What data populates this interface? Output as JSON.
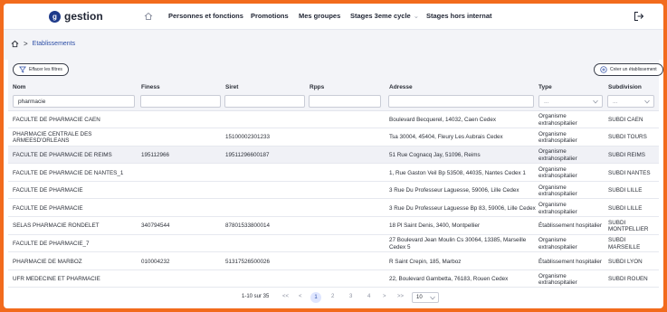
{
  "app": {
    "logo_text": "gestion"
  },
  "nav": {
    "items": [
      {
        "label": "Personnes et fonctions"
      },
      {
        "label": "Promotions"
      },
      {
        "label": "Mes groupes"
      },
      {
        "label": "Stages 3eme cycle",
        "caret": "⌄"
      },
      {
        "label": "Stages hors internat"
      }
    ]
  },
  "breadcrumb": {
    "current": "Etablissements",
    "separator": ">"
  },
  "toolbar": {
    "clear_filters": "Effacer les filtres",
    "create": "Créer un établissement"
  },
  "table": {
    "columns": [
      "Nom",
      "Finess",
      "Siret",
      "Rpps",
      "Adresse",
      "Type",
      "Subdivision"
    ],
    "filters": {
      "nom_value": "pharmacie",
      "type_placeholder": "...",
      "subdivision_placeholder": "..."
    },
    "rows": [
      {
        "nom": "FACULTE DE PHARMACIE CAEN",
        "finess": "",
        "siret": "",
        "rpps": "",
        "adresse": "Boulevard Becquerel, 14032, Caen Cedex",
        "type": "Organisme extrahospitalier",
        "subdivision": "SUBDI CAEN"
      },
      {
        "nom": "PHARMACIE CENTRALE DES ARMEESD'ORLEANS",
        "finess": "",
        "siret": "15100002301233",
        "rpps": "",
        "adresse": "Tsa 30004, 45404, Fleury Les Aubrais Cedex",
        "type": "Organisme extrahospitalier",
        "subdivision": "SUBDI TOURS"
      },
      {
        "nom": "FACULTE DE PHARMACIE DE REIMS",
        "finess": "195112966",
        "siret": "19511296600187",
        "rpps": "",
        "adresse": "51 Rue Cognacq Jay, 51096, Reims",
        "type": "Organisme extrahospitalier",
        "subdivision": "SUBDI REIMS"
      },
      {
        "nom": "FACULTE DE PHARMACIE DE NANTES_1",
        "finess": "",
        "siret": "",
        "rpps": "",
        "adresse": "1, Rue Gaston Veil Bp 53508, 44035, Nantes Cedex 1",
        "type": "Organisme extrahospitalier",
        "subdivision": "SUBDI NANTES"
      },
      {
        "nom": "FACULTE DE PHARMACIE",
        "finess": "",
        "siret": "",
        "rpps": "",
        "adresse": "3 Rue Du Professeur Laguesse, 59006, Lille Cedex",
        "type": "Organisme extrahospitalier",
        "subdivision": "SUBDI LILLE"
      },
      {
        "nom": "FACULTE DE PHARMACIE",
        "finess": "",
        "siret": "",
        "rpps": "",
        "adresse": "3 Rue Du Professeur Laguesse Bp 83, 59006, Lille Cedex",
        "type": "Organisme extrahospitalier",
        "subdivision": "SUBDI LILLE"
      },
      {
        "nom": "SELAS PHARMACIE RONDELET",
        "finess": "340794544",
        "siret": "87801533800014",
        "rpps": "",
        "adresse": "18 Pl Saint Denis, 3400, Montpellier",
        "type": "Établissement hospitalier",
        "subdivision": "SUBDI MONTPELLIER"
      },
      {
        "nom": "FACULTE DE PHARMACIE_7",
        "finess": "",
        "siret": "",
        "rpps": "",
        "adresse": "27 Boulevard Jean Moulin Cs 30064, 13385, Marseille Cedex 5",
        "type": "Organisme extrahospitalier",
        "subdivision": "SUBDI MARSEILLE"
      },
      {
        "nom": "PHARMACIE DE MARBOZ",
        "finess": "010004232",
        "siret": "51317526500026",
        "rpps": "",
        "adresse": "R Saint Crepin, 185, Marboz",
        "type": "Établissement hospitalier",
        "subdivision": "SUBDI LYON"
      },
      {
        "nom": "UFR MEDECINE ET PHARMACIE",
        "finess": "",
        "siret": "",
        "rpps": "",
        "adresse": "22, Boulevard Gambetta, 76183, Rouen Cedex",
        "type": "Organisme extrahospitalier",
        "subdivision": "SUBDI ROUEN"
      }
    ]
  },
  "pagination": {
    "range": "1-10 sur 35",
    "first": "<<",
    "prev": "<",
    "pages": [
      "1",
      "2",
      "3",
      "4"
    ],
    "next": ">",
    "last": ">>",
    "current_page": "1",
    "page_size": "10"
  }
}
